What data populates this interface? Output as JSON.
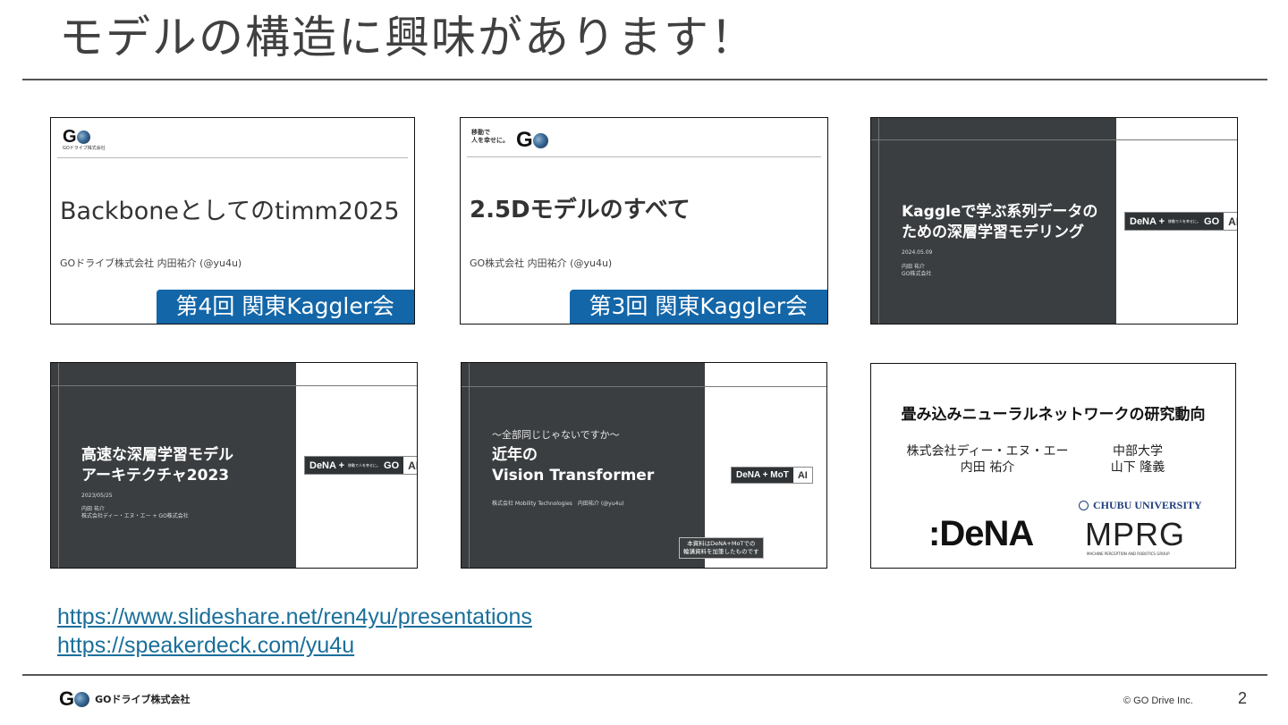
{
  "slide": {
    "title": "モデルの構造に興味があります！",
    "page_number": "2"
  },
  "thumbnails": [
    {
      "logo_letter": "G",
      "logo_caption": "GOドライブ株式会社",
      "title": "Backboneとしてのtimm2025",
      "author": "GOドライブ株式会社 内田祐介 (@yu4u)",
      "badge": "第4回 関東Kaggler会"
    },
    {
      "logo_tagline_1": "移動で",
      "logo_tagline_2": "人を幸せに。",
      "logo_letter": "G",
      "title": "2.5Dモデルのすべて",
      "author": "GO株式会社 内田祐介 (@yu4u)",
      "badge": "第3回 関東Kaggler会"
    },
    {
      "title_line1": "Kaggleで学ぶ系列データの",
      "title_line2": "ための深層学習モデリング",
      "date": "2024.05.09",
      "author_line1": "内田 祐介",
      "author_line2": "GO株式会社",
      "logo_left": "DeNA + ",
      "logo_tagline": "移動で人を幸せに。",
      "logo_go": "GO",
      "logo_ai": "AI"
    },
    {
      "title_line1": "高速な深層学習モデル",
      "title_line2": "アーキテクチャ2023",
      "date": "2023/05/25",
      "author_line1": "内田 祐介",
      "author_line2": "株式会社ディー・エヌ・エー + GO株式会社",
      "logo_left": "DeNA + ",
      "logo_tagline": "移動で人を幸せに。",
      "logo_go": "GO",
      "logo_ai": "AI"
    },
    {
      "subtitle": "〜全部同じじゃないですか〜",
      "title_line1": "近年の",
      "title_line2": "Vision Transformer",
      "author": "株式会社 Mobility Technologies　内田祐介 (@yu4u)",
      "note_line1": "本資料はDeNA+MoTでの",
      "note_line2": "輪講資料を加筆したものです",
      "logo_left": "DeNA + MoT",
      "logo_ai": "AI"
    },
    {
      "title": "畳み込みニューラルネットワークの研究動向",
      "aff_left_1": "株式会社ディー・エヌ・エー",
      "aff_left_2": "内田 祐介",
      "aff_right_1": "中部大学",
      "aff_right_2": "山下 隆義",
      "dena_logo": ":DeNA",
      "chubu_logo": "CHUBU UNIVERSITY",
      "mprg_logo": "MPRG",
      "mprg_caption": "MACHINE PERCEPTION AND ROBOTICS GROUP"
    }
  ],
  "links": [
    "https://www.slideshare.net/ren4yu/presentations",
    "https://speakerdeck.com/yu4u"
  ],
  "footer": {
    "logo_letter": "G",
    "company": "GOドライブ株式会社",
    "copyright": "© GO Drive Inc."
  }
}
